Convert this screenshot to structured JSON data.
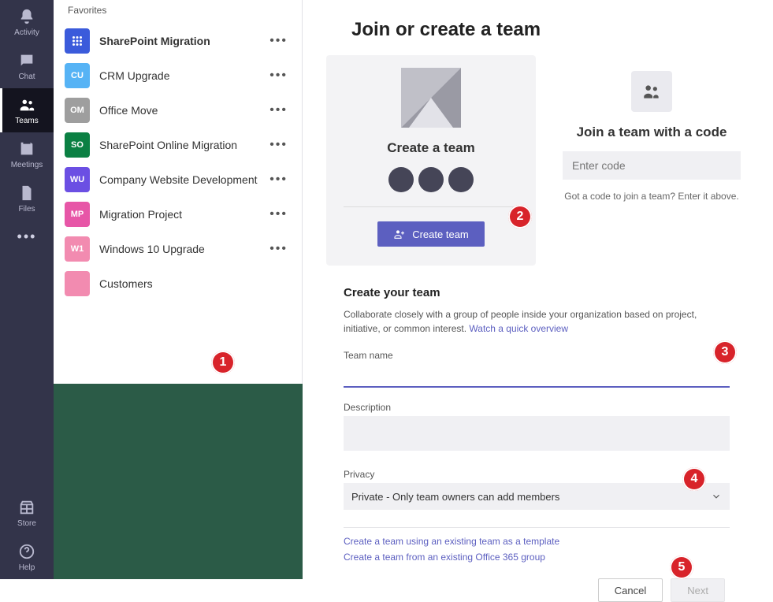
{
  "rail": {
    "activity": "Activity",
    "chat": "Chat",
    "teams": "Teams",
    "meetings": "Meetings",
    "files": "Files",
    "store": "Store",
    "help": "Help"
  },
  "sidebar": {
    "section": "Favorites",
    "items": [
      {
        "initials": "",
        "label": "SharePoint Migration",
        "color": "#3b5bdb",
        "bold": true,
        "icon": "grid"
      },
      {
        "initials": "CU",
        "label": "CRM Upgrade",
        "color": "#56b3f5"
      },
      {
        "initials": "OM",
        "label": "Office Move",
        "color": "#9e9e9e"
      },
      {
        "initials": "SO",
        "label": "SharePoint Online Migration",
        "color": "#0b8043"
      },
      {
        "initials": "WU",
        "label": "Company Website Development",
        "color": "#6b4fe3"
      },
      {
        "initials": "MP",
        "label": "Migration Project",
        "color": "#e756a7"
      },
      {
        "initials": "W1",
        "label": "Windows 10 Upgrade",
        "color": "#f28bb0"
      },
      {
        "initials": "",
        "label": "Customers",
        "color": "#f28bb0"
      }
    ],
    "join_link": "Join or create a team"
  },
  "main": {
    "page_title": "Join or create a team",
    "create_card": {
      "title": "Create a team",
      "button": "Create team"
    },
    "join_card": {
      "title": "Join a team with a code",
      "placeholder": "Enter code",
      "hint": "Got a code to join a team? Enter it above."
    },
    "form": {
      "title": "Create your team",
      "desc_text": "Collaborate closely with a group of people inside your organization based on project, initiative, or common interest. ",
      "desc_link": "Watch a quick overview",
      "name_label": "Team name",
      "name_value": "",
      "desc_label": "Description",
      "desc_value": "",
      "privacy_label": "Privacy",
      "privacy_value": "Private - Only team owners can add members",
      "tpl_link_1": "Create a team using an existing team as a template",
      "tpl_link_2": "Create a team from an existing Office 365 group",
      "cancel": "Cancel",
      "next": "Next"
    }
  },
  "annotations": {
    "a1": "1",
    "a2": "2",
    "a3": "3",
    "a4": "4",
    "a5": "5"
  }
}
